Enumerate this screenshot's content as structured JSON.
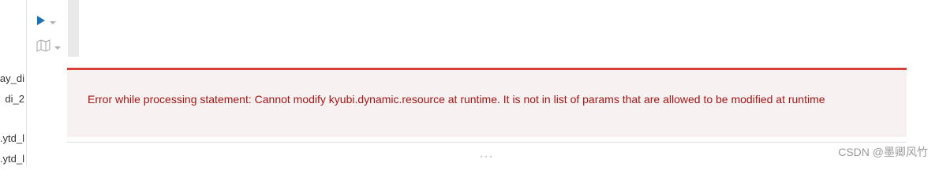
{
  "sidebar": {
    "items": [
      {
        "label": "ay_di"
      },
      {
        "label": "di_2"
      },
      {
        "label": ".ytd_l"
      },
      {
        "label": ".ytd_l"
      }
    ]
  },
  "toolbar": {
    "run_icon": "play-icon",
    "run_dropdown_icon": "caret-down-icon",
    "map_icon": "map-icon",
    "map_dropdown_icon": "caret-down-icon"
  },
  "error": {
    "message": "Error while processing statement: Cannot modify kyubi.dynamic.resource at runtime. It is not in list of params that are allowed to be modified at runtime"
  },
  "watermark": {
    "text": "CSDN @墨卿风竹"
  },
  "colors": {
    "error_border": "#d9403a",
    "error_bg": "#f8f1f1",
    "error_text": "#a31515",
    "run_icon": "#1a73b8",
    "muted_icon": "#b0b0b0"
  }
}
